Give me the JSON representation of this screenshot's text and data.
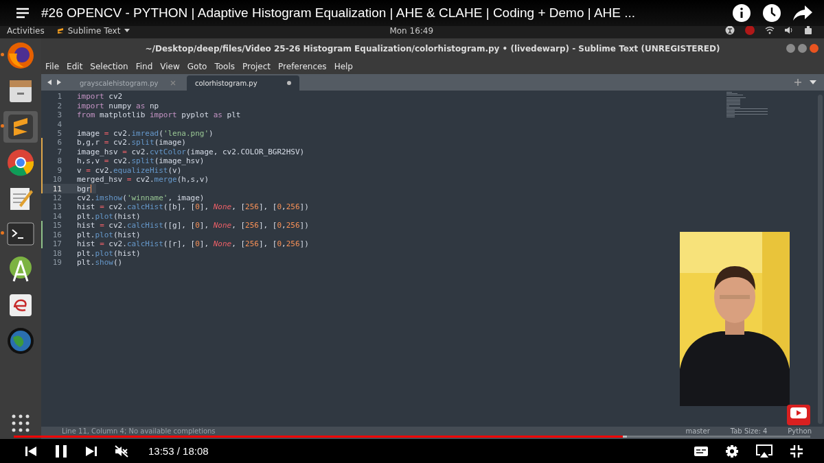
{
  "video_title": "#26 OPENCV - PYTHON | Adaptive Histogram Equalization | AHE & CLAHE | Coding + Demo | AHE ...",
  "top_panel": {
    "activities": "Activities",
    "app_menu": "Sublime Text",
    "clock": "Mon 16:49"
  },
  "window": {
    "title": "~/Desktop/deep/files/Video 25-26 Histogram Equalization/colorhistogram.py • (livedewarp) - Sublime Text (UNREGISTERED)"
  },
  "menu": [
    "File",
    "Edit",
    "Selection",
    "Find",
    "View",
    "Goto",
    "Tools",
    "Project",
    "Preferences",
    "Help"
  ],
  "tabs": [
    {
      "label": "grayscalehistogram.py",
      "selected": false,
      "dirty": false
    },
    {
      "label": "colorhistogram.py",
      "selected": true,
      "dirty": true
    }
  ],
  "dock": [
    {
      "kind": "firefox",
      "running": true,
      "selected": false
    },
    {
      "kind": "files",
      "running": false,
      "selected": false
    },
    {
      "kind": "sublime",
      "running": true,
      "selected": true
    },
    {
      "kind": "chrome",
      "running": false,
      "selected": false
    },
    {
      "kind": "editor",
      "running": false,
      "selected": false
    },
    {
      "kind": "terminal",
      "running": true,
      "selected": false
    },
    {
      "kind": "android",
      "running": false,
      "selected": false
    },
    {
      "kind": "eclipse",
      "running": false,
      "selected": false
    },
    {
      "kind": "globe",
      "running": false,
      "selected": false
    }
  ],
  "code_lines": [
    {
      "number": "1",
      "modified": false,
      "added": false,
      "current": false,
      "tokens": [
        {
          "text": "import",
          "kind": "kw"
        },
        {
          "text": " cv2",
          "kind": "plain"
        }
      ]
    },
    {
      "number": "2",
      "modified": false,
      "added": false,
      "current": false,
      "tokens": [
        {
          "text": "import",
          "kind": "kw"
        },
        {
          "text": " numpy ",
          "kind": "plain"
        },
        {
          "text": "as",
          "kind": "kw"
        },
        {
          "text": " np",
          "kind": "plain"
        }
      ]
    },
    {
      "number": "3",
      "modified": false,
      "added": false,
      "current": false,
      "tokens": [
        {
          "text": "from",
          "kind": "kw"
        },
        {
          "text": " matplotlib ",
          "kind": "plain"
        },
        {
          "text": "import",
          "kind": "kw"
        },
        {
          "text": " pyplot ",
          "kind": "plain"
        },
        {
          "text": "as",
          "kind": "kw"
        },
        {
          "text": " plt",
          "kind": "plain"
        }
      ]
    },
    {
      "number": "4",
      "modified": false,
      "added": false,
      "current": false
    },
    {
      "number": "5",
      "modified": false,
      "added": false,
      "current": false,
      "tokens": [
        {
          "text": "image ",
          "kind": "plain"
        },
        {
          "text": "=",
          "kind": "op"
        },
        {
          "text": " cv2.",
          "kind": "plain"
        },
        {
          "text": "imread",
          "kind": "fn"
        },
        {
          "text": "(",
          "kind": "plain"
        },
        {
          "text": "'lena.png'",
          "kind": "str"
        },
        {
          "text": ")",
          "kind": "plain"
        }
      ]
    },
    {
      "number": "6",
      "modified": true,
      "added": false,
      "current": false,
      "tokens": [
        {
          "text": "b,g,r ",
          "kind": "plain"
        },
        {
          "text": "=",
          "kind": "op"
        },
        {
          "text": " cv2.",
          "kind": "plain"
        },
        {
          "text": "split",
          "kind": "fn"
        },
        {
          "text": "(image)",
          "kind": "plain"
        }
      ]
    },
    {
      "number": "7",
      "modified": true,
      "added": false,
      "current": false,
      "tokens": [
        {
          "text": "image_hsv ",
          "kind": "plain"
        },
        {
          "text": "=",
          "kind": "op"
        },
        {
          "text": " cv2.",
          "kind": "plain"
        },
        {
          "text": "cvtColor",
          "kind": "fn"
        },
        {
          "text": "(image, cv2.COLOR_BGR2HSV)",
          "kind": "plain"
        }
      ]
    },
    {
      "number": "8",
      "modified": true,
      "added": false,
      "current": false,
      "tokens": [
        {
          "text": "h,s,v ",
          "kind": "plain"
        },
        {
          "text": "=",
          "kind": "op"
        },
        {
          "text": " cv2.",
          "kind": "plain"
        },
        {
          "text": "split",
          "kind": "fn"
        },
        {
          "text": "(image_hsv)",
          "kind": "plain"
        }
      ]
    },
    {
      "number": "9",
      "modified": true,
      "added": false,
      "current": false,
      "tokens": [
        {
          "text": "v ",
          "kind": "plain"
        },
        {
          "text": "=",
          "kind": "op"
        },
        {
          "text": " cv2.",
          "kind": "plain"
        },
        {
          "text": "equalizeHist",
          "kind": "fn"
        },
        {
          "text": "(v)",
          "kind": "plain"
        }
      ]
    },
    {
      "number": "10",
      "modified": true,
      "added": false,
      "current": false,
      "tokens": [
        {
          "text": "merged_hsv ",
          "kind": "plain"
        },
        {
          "text": "=",
          "kind": "op"
        },
        {
          "text": " cv2.",
          "kind": "plain"
        },
        {
          "text": "merge",
          "kind": "fn"
        },
        {
          "text": "(h,s,v)",
          "kind": "plain"
        }
      ]
    },
    {
      "number": "11",
      "modified": true,
      "added": false,
      "current": true,
      "tokens": [
        {
          "text": "bgr",
          "kind": "plain"
        }
      ]
    },
    {
      "number": "12",
      "modified": false,
      "added": false,
      "current": false,
      "tokens": [
        {
          "text": "cv2.",
          "kind": "plain"
        },
        {
          "text": "imshow",
          "kind": "fn"
        },
        {
          "text": "(",
          "kind": "plain"
        },
        {
          "text": "'winname'",
          "kind": "str"
        },
        {
          "text": ", image)",
          "kind": "plain"
        }
      ]
    },
    {
      "number": "13",
      "modified": false,
      "added": false,
      "current": false,
      "tokens": [
        {
          "text": "hist ",
          "kind": "plain"
        },
        {
          "text": "=",
          "kind": "op"
        },
        {
          "text": " cv2.",
          "kind": "plain"
        },
        {
          "text": "calcHist",
          "kind": "fn"
        },
        {
          "text": "([b], [",
          "kind": "plain"
        },
        {
          "text": "0",
          "kind": "num"
        },
        {
          "text": "], ",
          "kind": "plain"
        },
        {
          "text": "None",
          "kind": "const"
        },
        {
          "text": ", [",
          "kind": "plain"
        },
        {
          "text": "256",
          "kind": "num"
        },
        {
          "text": "], [",
          "kind": "plain"
        },
        {
          "text": "0",
          "kind": "num"
        },
        {
          "text": ",",
          "kind": "plain"
        },
        {
          "text": "256",
          "kind": "num"
        },
        {
          "text": "])",
          "kind": "plain"
        }
      ]
    },
    {
      "number": "14",
      "modified": false,
      "added": false,
      "current": false,
      "tokens": [
        {
          "text": "plt.",
          "kind": "plain"
        },
        {
          "text": "plot",
          "kind": "fn"
        },
        {
          "text": "(hist)",
          "kind": "plain"
        }
      ]
    },
    {
      "number": "15",
      "modified": false,
      "added": true,
      "current": false,
      "tokens": [
        {
          "text": "hist ",
          "kind": "plain"
        },
        {
          "text": "=",
          "kind": "op"
        },
        {
          "text": " cv2.",
          "kind": "plain"
        },
        {
          "text": "calcHist",
          "kind": "fn"
        },
        {
          "text": "([g], [",
          "kind": "plain"
        },
        {
          "text": "0",
          "kind": "num"
        },
        {
          "text": "], ",
          "kind": "plain"
        },
        {
          "text": "None",
          "kind": "const"
        },
        {
          "text": ", [",
          "kind": "plain"
        },
        {
          "text": "256",
          "kind": "num"
        },
        {
          "text": "], [",
          "kind": "plain"
        },
        {
          "text": "0",
          "kind": "num"
        },
        {
          "text": ",",
          "kind": "plain"
        },
        {
          "text": "256",
          "kind": "num"
        },
        {
          "text": "])",
          "kind": "plain"
        }
      ]
    },
    {
      "number": "16",
      "modified": false,
      "added": true,
      "current": false,
      "tokens": [
        {
          "text": "plt.",
          "kind": "plain"
        },
        {
          "text": "plot",
          "kind": "fn"
        },
        {
          "text": "(hist)",
          "kind": "plain"
        }
      ]
    },
    {
      "number": "17",
      "modified": false,
      "added": true,
      "current": false,
      "tokens": [
        {
          "text": "hist ",
          "kind": "plain"
        },
        {
          "text": "=",
          "kind": "op"
        },
        {
          "text": " cv2.",
          "kind": "plain"
        },
        {
          "text": "calcHist",
          "kind": "fn"
        },
        {
          "text": "([r], [",
          "kind": "plain"
        },
        {
          "text": "0",
          "kind": "num"
        },
        {
          "text": "], ",
          "kind": "plain"
        },
        {
          "text": "None",
          "kind": "const"
        },
        {
          "text": ", [",
          "kind": "plain"
        },
        {
          "text": "256",
          "kind": "num"
        },
        {
          "text": "], [",
          "kind": "plain"
        },
        {
          "text": "0",
          "kind": "num"
        },
        {
          "text": ",",
          "kind": "plain"
        },
        {
          "text": "256",
          "kind": "num"
        },
        {
          "text": "])",
          "kind": "plain"
        }
      ]
    },
    {
      "number": "18",
      "modified": false,
      "added": false,
      "current": false,
      "tokens": [
        {
          "text": "plt.",
          "kind": "plain"
        },
        {
          "text": "plot",
          "kind": "fn"
        },
        {
          "text": "(hist)",
          "kind": "plain"
        }
      ]
    },
    {
      "number": "19",
      "modified": false,
      "added": false,
      "current": false,
      "tokens": [
        {
          "text": "plt.",
          "kind": "plain"
        },
        {
          "text": "show",
          "kind": "fn"
        },
        {
          "text": "()",
          "kind": "plain"
        }
      ]
    }
  ],
  "status_bar": {
    "position": "Line 11, Column 4; No available completions",
    "branch": "master",
    "tab_size": "Tab Size: 4",
    "syntax": "Python"
  },
  "player": {
    "level": 0.765,
    "time": "13:53 / 18:08",
    "playing": true,
    "muted": true
  }
}
